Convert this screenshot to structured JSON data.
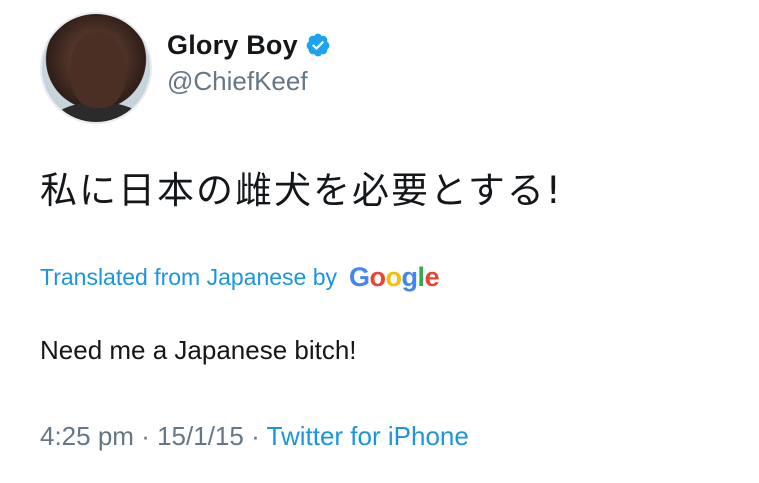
{
  "user": {
    "name": "Glory Boy",
    "handle": "@ChiefKeef",
    "verified_icon": "verified-badge-icon"
  },
  "tweet": {
    "text": "私に日本の雌犬を必要とする!",
    "translated_label": "Translated from Japanese by",
    "google_logo": "Google",
    "translation": "Need me a Japanese bitch!",
    "time": "4:25 pm",
    "separator": "·",
    "date": "15/1/15",
    "source": "Twitter for iPhone"
  },
  "colors": {
    "link_blue": "#1b95e0",
    "secondary_gray": "#657786",
    "text_dark": "#14171a"
  }
}
